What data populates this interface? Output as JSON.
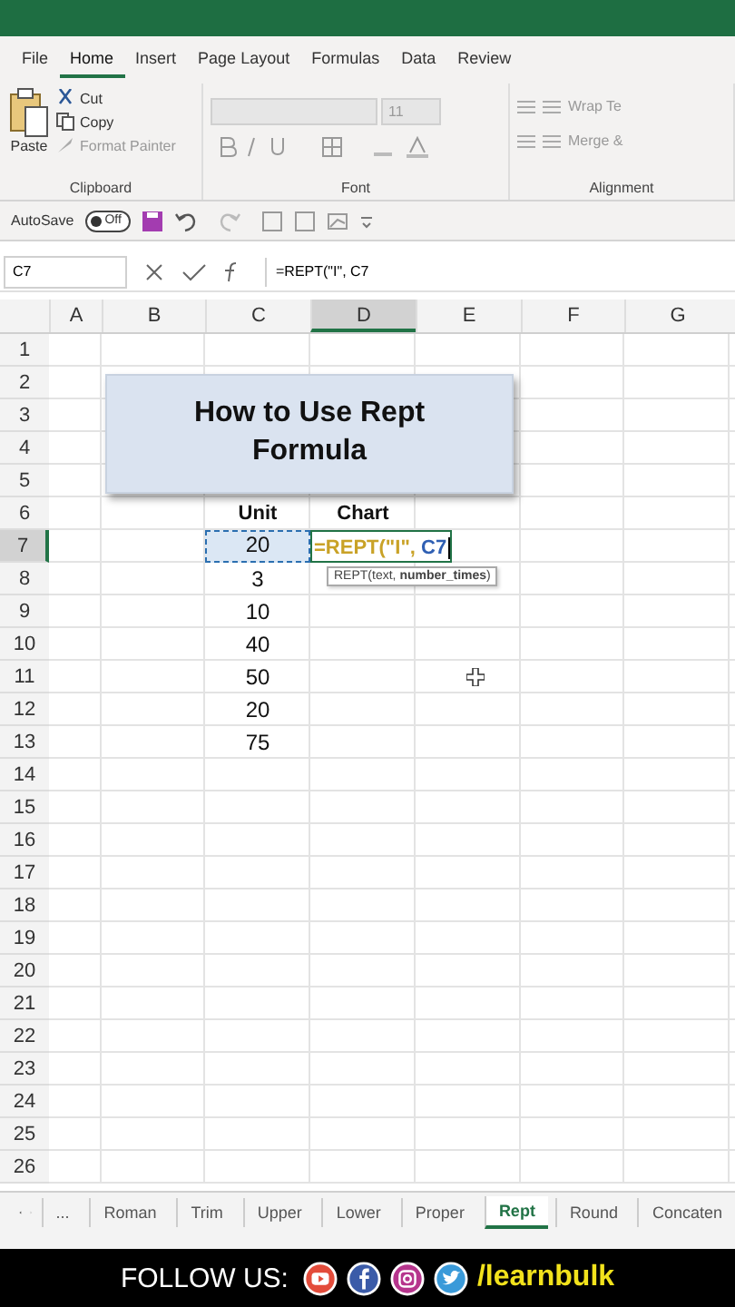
{
  "ribbon_tabs": [
    {
      "label": "File",
      "selected": false
    },
    {
      "label": "Home",
      "selected": true
    },
    {
      "label": "Insert",
      "selected": false
    },
    {
      "label": "Page Layout",
      "selected": false
    },
    {
      "label": "Formulas",
      "selected": false
    },
    {
      "label": "Data",
      "selected": false
    },
    {
      "label": "Review",
      "selected": false
    }
  ],
  "clipboard": {
    "paste": "Paste",
    "cut": "Cut",
    "copy": "Copy",
    "format_painter": "Format Painter",
    "label": "Clipboard"
  },
  "font": {
    "size": "11",
    "label": "Font"
  },
  "alignment": {
    "wrap": "Wrap Te",
    "merge": "Merge &",
    "label": "Alignment"
  },
  "quick_access": {
    "autosave": "AutoSave",
    "toggle": "Off",
    "autosave_on": false
  },
  "formula_bar": {
    "name_box": "C7",
    "formula": "=REPT(\"I\", C7"
  },
  "columns": [
    {
      "label": "A",
      "selected": false
    },
    {
      "label": "B",
      "selected": false
    },
    {
      "label": "C",
      "selected": false
    },
    {
      "label": "D",
      "selected": true
    },
    {
      "label": "E",
      "selected": false
    },
    {
      "label": "F",
      "selected": false
    },
    {
      "label": "G",
      "selected": false
    }
  ],
  "rows": [
    {
      "label": "1",
      "selected": false
    },
    {
      "label": "2",
      "selected": false
    },
    {
      "label": "3",
      "selected": false
    },
    {
      "label": "4",
      "selected": false
    },
    {
      "label": "5",
      "selected": false
    },
    {
      "label": "6",
      "selected": false
    },
    {
      "label": "7",
      "selected": true
    },
    {
      "label": "8",
      "selected": false
    },
    {
      "label": "9",
      "selected": false
    },
    {
      "label": "10",
      "selected": false
    },
    {
      "label": "11",
      "selected": false
    },
    {
      "label": "12",
      "selected": false
    },
    {
      "label": "13",
      "selected": false
    },
    {
      "label": "14",
      "selected": false
    },
    {
      "label": "15",
      "selected": false
    },
    {
      "label": "16",
      "selected": false
    },
    {
      "label": "17",
      "selected": false
    },
    {
      "label": "18",
      "selected": false
    },
    {
      "label": "19",
      "selected": false
    },
    {
      "label": "20",
      "selected": false
    },
    {
      "label": "21",
      "selected": false
    },
    {
      "label": "22",
      "selected": false
    },
    {
      "label": "23",
      "selected": false
    },
    {
      "label": "24",
      "selected": false
    },
    {
      "label": "25",
      "selected": false
    },
    {
      "label": "26",
      "selected": false
    }
  ],
  "title_card": {
    "text": "How to Use Rept Formula"
  },
  "table": {
    "headers": [
      "Unit",
      "Chart"
    ],
    "rows": [
      {
        "unit": "20",
        "copy_marquee": true
      },
      {
        "unit": "3",
        "copy_marquee": false
      },
      {
        "unit": "10",
        "copy_marquee": false
      },
      {
        "unit": "40",
        "copy_marquee": false
      },
      {
        "unit": "50",
        "copy_marquee": false
      },
      {
        "unit": "20",
        "copy_marquee": false
      },
      {
        "unit": "75",
        "copy_marquee": false
      }
    ]
  },
  "editing": {
    "parts": [
      {
        "text": "=REPT(\"I\", ",
        "kind": "function"
      },
      {
        "text": "C7",
        "kind": "reference"
      }
    ],
    "tooltip": "REPT(text, **number_times**)"
  },
  "sheet_tabs": [
    {
      "label": "...",
      "selected": false
    },
    {
      "label": "Roman",
      "selected": false
    },
    {
      "label": "Trim",
      "selected": false
    },
    {
      "label": "Upper",
      "selected": false
    },
    {
      "label": "Lower",
      "selected": false
    },
    {
      "label": "Proper",
      "selected": false
    },
    {
      "label": "Rept",
      "selected": true
    },
    {
      "label": "Round",
      "selected": false
    },
    {
      "label": "Concaten",
      "selected": false
    }
  ],
  "footer": {
    "follow": "FOLLOW US:",
    "handle": "/learnbulk"
  }
}
